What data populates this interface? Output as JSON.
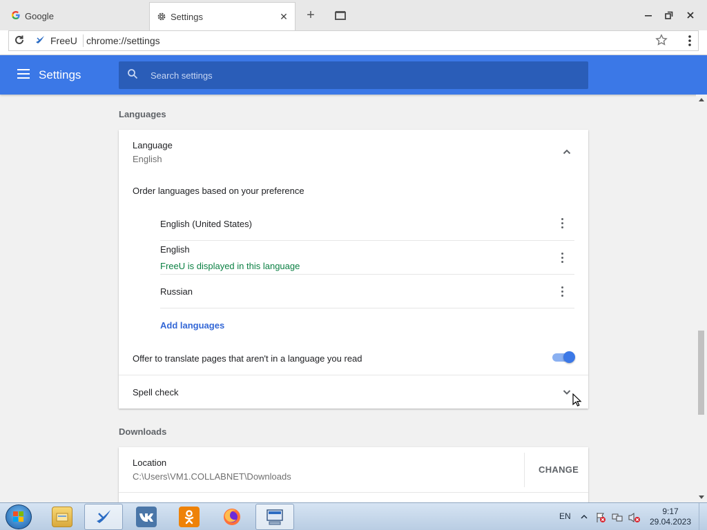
{
  "browser": {
    "tabs": [
      {
        "title": "Google",
        "icon": "google-icon"
      },
      {
        "title": "Settings",
        "icon": "gear-icon",
        "close": "✕"
      }
    ],
    "new_tab_symbol": "+",
    "window_controls": {
      "minimize": "—",
      "restore": "❐",
      "close": "✕"
    },
    "site_name": "FreeU",
    "url": "chrome://settings"
  },
  "app": {
    "title": "Settings",
    "search_placeholder": "Search settings",
    "accent": "#3b78e7"
  },
  "languages": {
    "section_title": "Languages",
    "language_label": "Language",
    "language_value": "English",
    "order_label": "Order languages based on your preference",
    "items": [
      {
        "name": "English (United States)",
        "note": ""
      },
      {
        "name": "English",
        "note": "FreeU is displayed in this language"
      },
      {
        "name": "Russian",
        "note": ""
      }
    ],
    "add_languages": "Add languages",
    "translate_label": "Offer to translate pages that aren't in a language you read",
    "translate_enabled": true,
    "spell_check_label": "Spell check"
  },
  "downloads": {
    "section_title": "Downloads",
    "location_label": "Location",
    "location_path": "C:\\Users\\VM1.COLLABNET\\Downloads",
    "change_label": "CHANGE"
  },
  "taskbar": {
    "apps": [
      "explorer-icon",
      "freeu-icon",
      "vk-icon",
      "odnoklassniki-icon",
      "firefox-icon",
      "remote-desktop-icon"
    ],
    "language": "EN",
    "time": "9:17",
    "date": "29.04.2023"
  }
}
